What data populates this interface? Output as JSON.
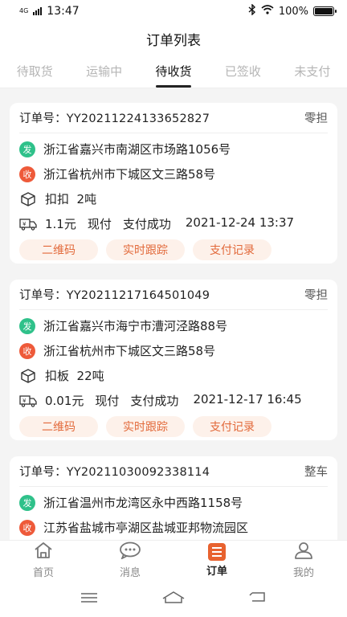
{
  "status": {
    "network": "4G",
    "time": "13:47",
    "battery": "100%"
  },
  "header": {
    "title": "订单列表"
  },
  "tabs": [
    {
      "label": "待取货",
      "active": false
    },
    {
      "label": "运输中",
      "active": false
    },
    {
      "label": "待收货",
      "active": true
    },
    {
      "label": "已签收",
      "active": false
    },
    {
      "label": "未支付",
      "active": false
    }
  ],
  "orders": [
    {
      "order_no": "订单号：YY20211224133652827",
      "type": "零担",
      "from_badge": "发",
      "from": "浙江省嘉兴市南湖区市场路1056号",
      "to_badge": "收",
      "to": "浙江省杭州市下城区文三路58号",
      "cargo": "扣扣  2吨",
      "fee": "1.1元",
      "pay_method": "现付",
      "pay_status": "支付成功",
      "time": "2021-12-24 13:37",
      "buttons": [
        "二维码",
        "实时跟踪",
        "支付记录"
      ]
    },
    {
      "order_no": "订单号：YY20211217164501049",
      "type": "零担",
      "from_badge": "发",
      "from": "浙江省嘉兴市海宁市漕河泾路88号",
      "to_badge": "收",
      "to": "浙江省杭州市下城区文三路58号",
      "cargo": "扣板  22吨",
      "fee": "0.01元",
      "pay_method": "现付",
      "pay_status": "支付成功",
      "time": "2021-12-17 16:45",
      "buttons": [
        "二维码",
        "实时跟踪",
        "支付记录"
      ]
    },
    {
      "order_no": "订单号：YY20211030092338114",
      "type": "整车",
      "from_badge": "发",
      "from": "浙江省温州市龙湾区永中西路1158号",
      "to_badge": "收",
      "to": "江苏省盐城市亭湖区盐城亚邦物流园区"
    }
  ],
  "tabbar": [
    {
      "label": "首页",
      "icon": "home-icon"
    },
    {
      "label": "消息",
      "icon": "chat-icon"
    },
    {
      "label": "订单",
      "icon": "order-icon"
    },
    {
      "label": "我的",
      "icon": "user-icon"
    }
  ],
  "colors": {
    "accent": "#e8622f",
    "send_badge": "#2fc18a",
    "receive_badge": "#ee5a3a",
    "button_bg": "#fdf1ea"
  }
}
